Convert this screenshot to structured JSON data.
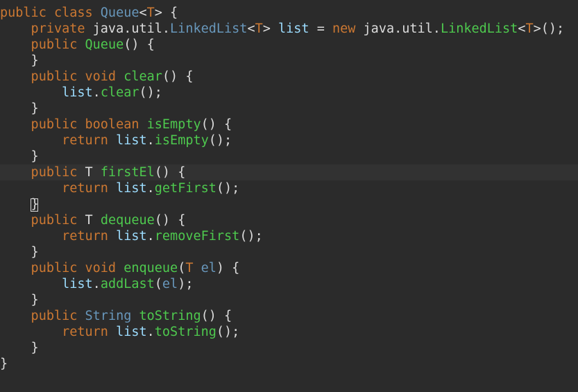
{
  "colors": {
    "background": "#2b2b2b",
    "current_line": "#323232",
    "keyword": "#cc7832",
    "type": "#6897bb",
    "method": "#4ec94e",
    "field": "#9cdcfe",
    "plain": "#dcdcdc"
  },
  "editor": {
    "current_line_index": 10,
    "lines": [
      [
        [
          "public class ",
          "keyword"
        ],
        [
          "Queue",
          "type"
        ],
        [
          "<",
          "plain"
        ],
        [
          "T",
          "keyword"
        ],
        [
          "> {",
          "plain"
        ]
      ],
      [
        [
          "    private ",
          "keyword"
        ],
        [
          "java.util.",
          "plain"
        ],
        [
          "LinkedList",
          "type"
        ],
        [
          "<",
          "plain"
        ],
        [
          "T",
          "keyword"
        ],
        [
          "> ",
          "plain"
        ],
        [
          "list",
          "field"
        ],
        [
          " = ",
          "plain"
        ],
        [
          "new ",
          "keyword"
        ],
        [
          "java.util.",
          "plain"
        ],
        [
          "LinkedList",
          "method"
        ],
        [
          "<",
          "plain"
        ],
        [
          "T",
          "keyword"
        ],
        [
          ">();",
          "plain"
        ]
      ],
      [
        [
          "    public ",
          "keyword"
        ],
        [
          "Queue",
          "method"
        ],
        [
          "() {",
          "plain"
        ]
      ],
      [
        [
          "    }",
          "plain"
        ]
      ],
      [
        [
          "    public void ",
          "keyword"
        ],
        [
          "clear",
          "method"
        ],
        [
          "() {",
          "plain"
        ]
      ],
      [
        [
          "        ",
          "plain"
        ],
        [
          "list",
          "field"
        ],
        [
          ".",
          "plain"
        ],
        [
          "clear",
          "method"
        ],
        [
          "();",
          "plain"
        ]
      ],
      [
        [
          "    }",
          "plain"
        ]
      ],
      [
        [
          "    public boolean ",
          "keyword"
        ],
        [
          "isEmpty",
          "method"
        ],
        [
          "() {",
          "plain"
        ]
      ],
      [
        [
          "        return ",
          "keyword"
        ],
        [
          "list",
          "field"
        ],
        [
          ".",
          "plain"
        ],
        [
          "isEmpty",
          "method"
        ],
        [
          "();",
          "plain"
        ]
      ],
      [
        [
          "    }",
          "plain"
        ]
      ],
      [
        [
          "    public ",
          "keyword"
        ],
        [
          "T ",
          "plain"
        ],
        [
          "firstEl",
          "method"
        ],
        [
          "() {",
          "plain"
        ]
      ],
      [
        [
          "        return ",
          "keyword"
        ],
        [
          "list",
          "field"
        ],
        [
          ".",
          "plain"
        ],
        [
          "getFirst",
          "method"
        ],
        [
          "();",
          "plain"
        ]
      ],
      [
        [
          "    }",
          "plain"
        ]
      ],
      [
        [
          "    public ",
          "keyword"
        ],
        [
          "T ",
          "plain"
        ],
        [
          "dequeue",
          "method"
        ],
        [
          "() {",
          "plain"
        ]
      ],
      [
        [
          "        return ",
          "keyword"
        ],
        [
          "list",
          "field"
        ],
        [
          ".",
          "plain"
        ],
        [
          "removeFirst",
          "method"
        ],
        [
          "();",
          "plain"
        ]
      ],
      [
        [
          "    }",
          "plain"
        ]
      ],
      [
        [
          "    public void ",
          "keyword"
        ],
        [
          "enqueue",
          "method"
        ],
        [
          "(",
          "plain"
        ],
        [
          "T ",
          "keyword"
        ],
        [
          "el",
          "type"
        ],
        [
          ") {",
          "plain"
        ]
      ],
      [
        [
          "        ",
          "plain"
        ],
        [
          "list",
          "field"
        ],
        [
          ".",
          "plain"
        ],
        [
          "addLast",
          "method"
        ],
        [
          "(",
          "plain"
        ],
        [
          "el",
          "type"
        ],
        [
          ");",
          "plain"
        ]
      ],
      [
        [
          "    }",
          "plain"
        ]
      ],
      [
        [
          "    public ",
          "keyword"
        ],
        [
          "String ",
          "type"
        ],
        [
          "toString",
          "method"
        ],
        [
          "() {",
          "plain"
        ]
      ],
      [
        [
          "        return ",
          "keyword"
        ],
        [
          "list",
          "field"
        ],
        [
          ".",
          "plain"
        ],
        [
          "toString",
          "method"
        ],
        [
          "();",
          "plain"
        ]
      ],
      [
        [
          "    }",
          "plain"
        ]
      ],
      [
        [
          "}",
          "plain"
        ]
      ]
    ]
  }
}
